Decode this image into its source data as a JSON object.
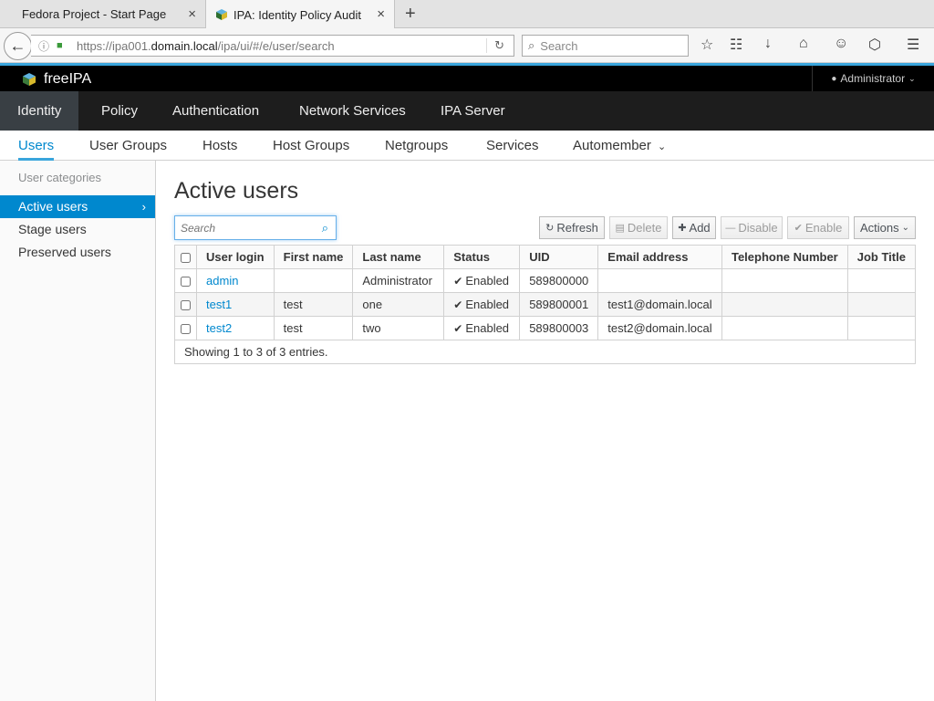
{
  "browser": {
    "tabs": [
      {
        "title": "Fedora Project - Start Page",
        "active": false
      },
      {
        "title": "IPA: Identity Policy Audit",
        "active": true
      }
    ],
    "close_glyph": "×",
    "newtab_glyph": "+",
    "url_prefix": "https://ipa001.",
    "url_domain": "domain.local",
    "url_path": "/ipa/ui/#/e/user/search",
    "search_placeholder": "Search",
    "icons": [
      "back-icon",
      "info-icon",
      "lock-icon",
      "reload-icon",
      "bookmark-star-icon",
      "reading-list-icon",
      "download-icon",
      "home-icon",
      "chat-icon",
      "pocket-icon",
      "hamburger-menu-icon"
    ]
  },
  "masthead": {
    "logo_text": "freeIPA",
    "user": "Administrator"
  },
  "primary_nav": [
    {
      "label": "Identity",
      "active": true
    },
    {
      "label": "Policy",
      "active": false
    },
    {
      "label": "Authentication",
      "active": false
    },
    {
      "label": "Network Services",
      "active": false
    },
    {
      "label": "IPA Server",
      "active": false
    }
  ],
  "secondary_nav": [
    {
      "label": "Users",
      "active": true
    },
    {
      "label": "User Groups",
      "active": false
    },
    {
      "label": "Hosts",
      "active": false
    },
    {
      "label": "Host Groups",
      "active": false
    },
    {
      "label": "Netgroups",
      "active": false
    },
    {
      "label": "Services",
      "active": false
    },
    {
      "label": "Automember",
      "active": false
    }
  ],
  "sidebar": {
    "heading": "User categories",
    "items": [
      {
        "label": "Active users",
        "active": true
      },
      {
        "label": "Stage users",
        "active": false
      },
      {
        "label": "Preserved users",
        "active": false
      }
    ]
  },
  "main": {
    "title": "Active users",
    "search_placeholder": "Search",
    "toolbar": {
      "refresh": "Refresh",
      "delete": "Delete",
      "add": "Add",
      "disable": "Disable",
      "enable": "Enable",
      "actions": "Actions"
    },
    "columns": [
      "User login",
      "First name",
      "Last name",
      "Status",
      "UID",
      "Email address",
      "Telephone Number",
      "Job Title"
    ],
    "rows": [
      {
        "login": "admin",
        "first": "",
        "last": "Administrator",
        "status": "Enabled",
        "uid": "589800000",
        "email": "",
        "phone": "",
        "job": ""
      },
      {
        "login": "test1",
        "first": "test",
        "last": "one",
        "status": "Enabled",
        "uid": "589800001",
        "email": "test1@domain.local",
        "phone": "",
        "job": ""
      },
      {
        "login": "test2",
        "first": "test",
        "last": "two",
        "status": "Enabled",
        "uid": "589800003",
        "email": "test2@domain.local",
        "phone": "",
        "job": ""
      }
    ],
    "footer": "Showing 1 to 3 of 3 entries."
  },
  "colors": {
    "accent": "#0088ce",
    "masthead": "#000000",
    "primary_nav": "#1d1d1d",
    "primary_active": "#393f44"
  }
}
